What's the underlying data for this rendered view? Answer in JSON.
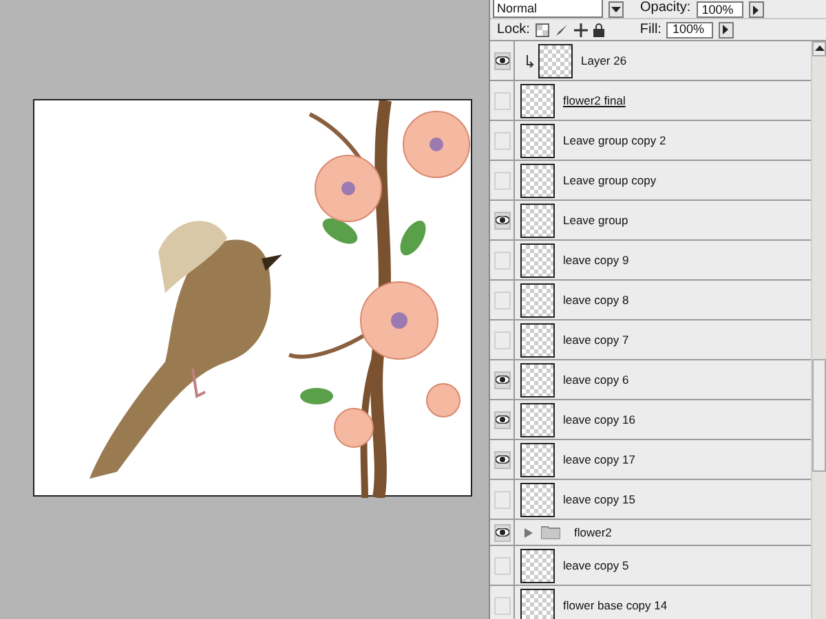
{
  "blend_mode": {
    "value": "Normal"
  },
  "opacity": {
    "label": "Opacity:",
    "value": "100%"
  },
  "lock": {
    "label": "Lock:"
  },
  "fill": {
    "label": "Fill:",
    "value": "100%"
  },
  "layers": [
    {
      "kind": "layer",
      "name": "Layer 26",
      "visible": true,
      "clipped": true,
      "underlined": false
    },
    {
      "kind": "layer",
      "name": "flower2 final",
      "visible": false,
      "clipped": false,
      "underlined": true
    },
    {
      "kind": "layer",
      "name": "Leave group copy 2",
      "visible": false,
      "clipped": false,
      "underlined": false
    },
    {
      "kind": "layer",
      "name": "Leave group copy",
      "visible": false,
      "clipped": false,
      "underlined": false
    },
    {
      "kind": "layer",
      "name": "Leave group",
      "visible": true,
      "clipped": false,
      "underlined": false
    },
    {
      "kind": "layer",
      "name": "leave copy 9",
      "visible": false,
      "clipped": false,
      "underlined": false
    },
    {
      "kind": "layer",
      "name": "leave copy 8",
      "visible": false,
      "clipped": false,
      "underlined": false
    },
    {
      "kind": "layer",
      "name": "leave copy 7",
      "visible": false,
      "clipped": false,
      "underlined": false
    },
    {
      "kind": "layer",
      "name": "leave copy 6",
      "visible": true,
      "clipped": false,
      "underlined": false
    },
    {
      "kind": "layer",
      "name": "leave copy 16",
      "visible": true,
      "clipped": false,
      "underlined": false
    },
    {
      "kind": "layer",
      "name": "leave copy 17",
      "visible": true,
      "clipped": false,
      "underlined": false
    },
    {
      "kind": "layer",
      "name": "leave copy 15",
      "visible": false,
      "clipped": false,
      "underlined": false
    },
    {
      "kind": "group",
      "name": "flower2",
      "visible": true,
      "expanded": false,
      "clipped": false,
      "underlined": false
    },
    {
      "kind": "layer",
      "name": "leave copy 5",
      "visible": false,
      "clipped": false,
      "underlined": false
    },
    {
      "kind": "layer",
      "name": "flower base copy 14",
      "visible": false,
      "clipped": false,
      "underlined": false
    }
  ]
}
